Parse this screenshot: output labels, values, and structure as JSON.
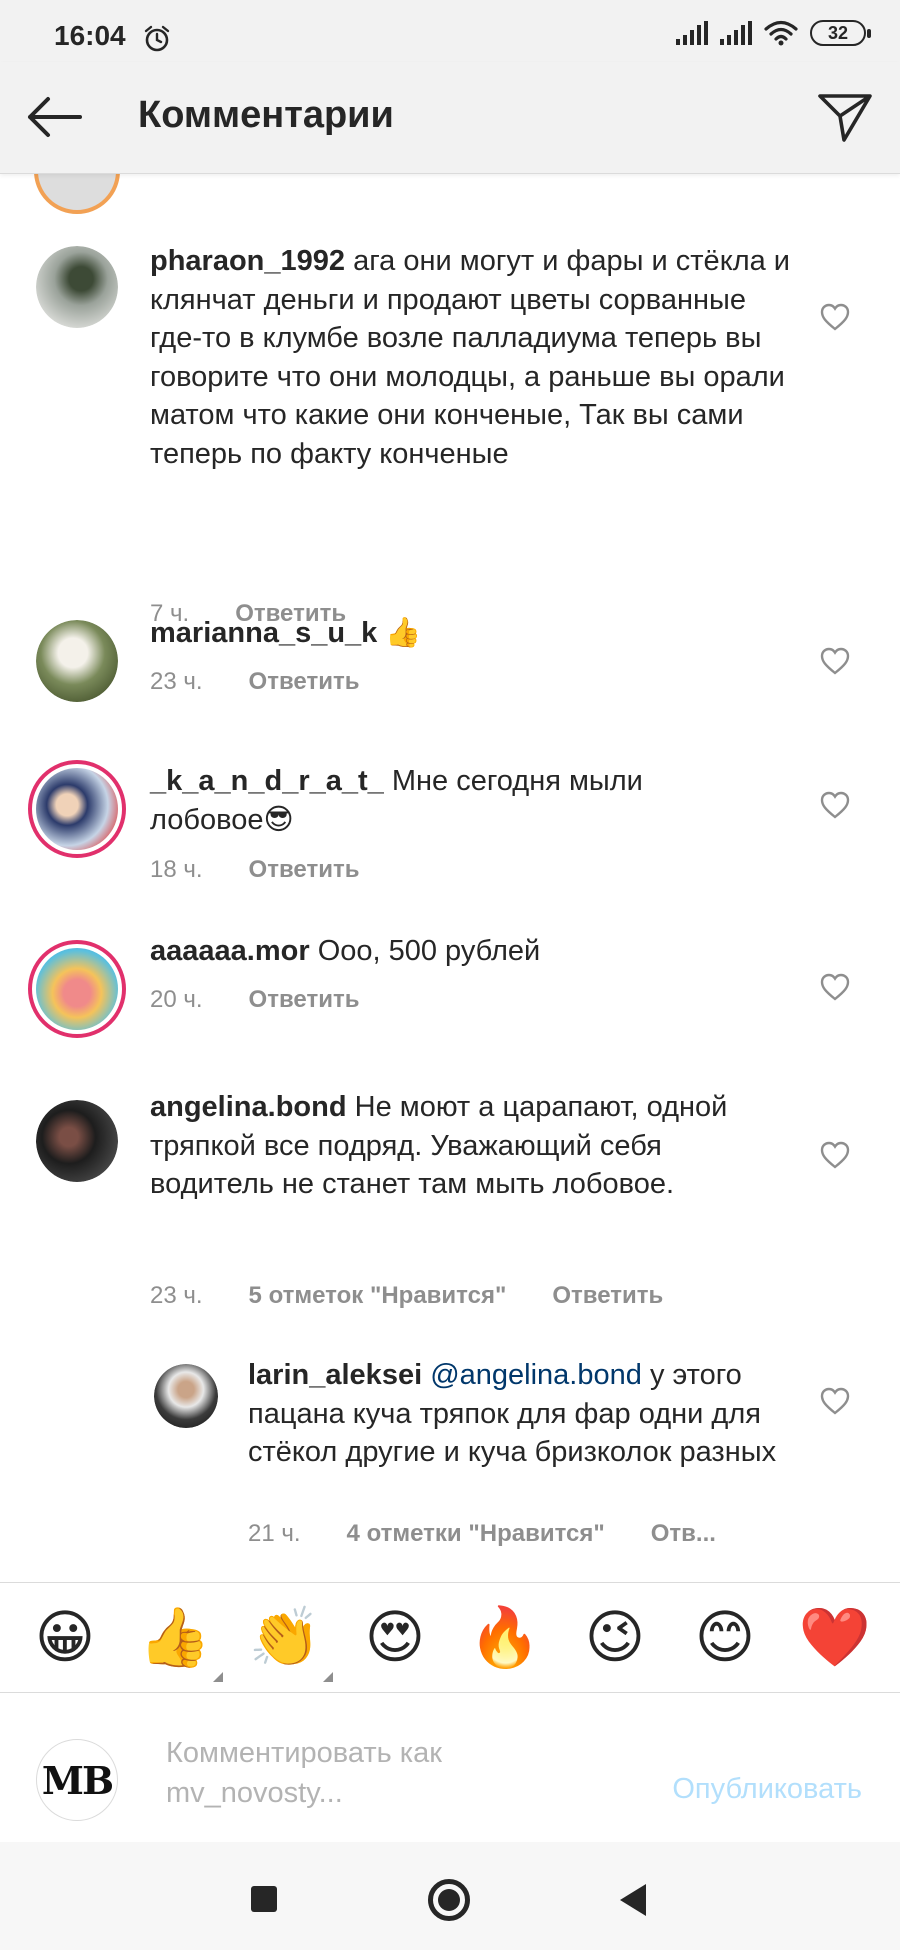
{
  "status_bar": {
    "time": "16:04",
    "battery": "32",
    "icons": [
      "alarm-icon",
      "signal-icon",
      "signal-icon",
      "wifi-icon",
      "battery-icon"
    ]
  },
  "header": {
    "title": "Комментарии",
    "back_icon": "arrow-left-icon",
    "share_icon": "paper-plane-icon"
  },
  "comments": [
    {
      "username": "pharaon_1992",
      "text": "ага они могут и фары и стёкла и клянчат деньги и продают цветы сорванные где-то в клумбе возле палладиума теперь вы говорите что они молодцы, а раньше вы орали матом что какие они конченые, Так вы сами теперь по факту конченые",
      "time": "7 ч.",
      "likes": "",
      "reply": "Ответить"
    },
    {
      "username": "marianna_s_u_k",
      "text": "👍",
      "time": "23 ч.",
      "likes": "",
      "reply": "Ответить"
    },
    {
      "username": "_k_a_n_d_r_a_t_",
      "text": "Мне сегодня мыли лобовое😎",
      "time": "18 ч.",
      "likes": "",
      "reply": "Ответить"
    },
    {
      "username": "aaaaaa.mor",
      "text": "Ооо, 500 рублей",
      "time": "20 ч.",
      "likes": "",
      "reply": "Ответить"
    },
    {
      "username": "angelina.bond",
      "text": "Не моют а царапают, одной тряпкой все подряд. Уважающий себя водитель не станет там мыть лобовое.",
      "time": "23 ч.",
      "likes": "5 отметок \"Нравится\"",
      "reply": "Ответить"
    },
    {
      "username": "larin_aleksei",
      "mention": "@angelina.bond",
      "text": "у этого пацана куча тряпок для фар одни для стёкол другие и куча бризколок разных",
      "time": "21 ч.",
      "likes": "4 отметки \"Нравится\"",
      "reply": "Отв..."
    }
  ],
  "emoji_bar": [
    "😀",
    "👍",
    "👏",
    "😍",
    "🔥",
    "😉",
    "😊",
    "❤️"
  ],
  "composer": {
    "avatar_text": "MB",
    "placeholder_line1": "Комментировать как",
    "placeholder_line2": "mv_novosty...",
    "publish_label": "Опубликовать"
  },
  "nav_bar": {
    "icons": [
      "recents-square-icon",
      "home-circle-icon",
      "back-triangle-icon"
    ]
  }
}
